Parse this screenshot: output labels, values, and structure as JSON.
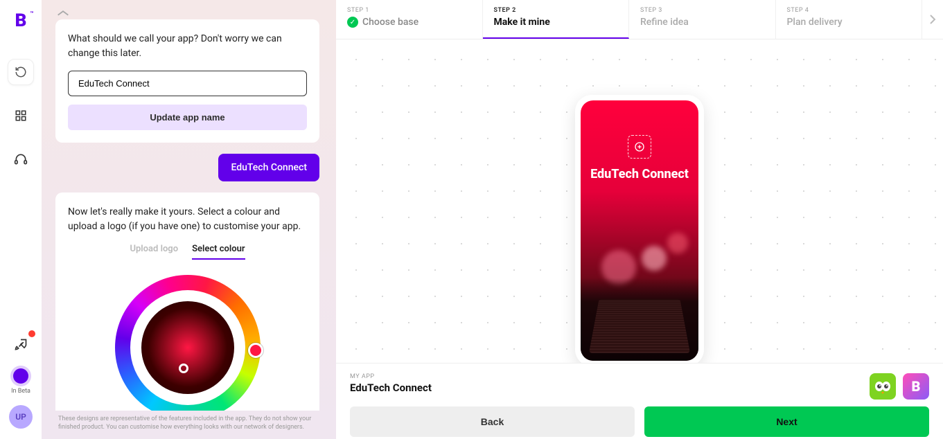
{
  "sidebar": {
    "logo": "B",
    "beta_label": "In Beta",
    "avatar_initials": "UP"
  },
  "chat": {
    "card1": {
      "text": "What should we call your app? Don't worry we can change this later.",
      "input_value": "EduTech Connect",
      "button": "Update app name"
    },
    "user_reply": "EduTech Connect",
    "card2": {
      "text": "Now let's really make it yours. Select a colour and upload a logo (if you have one) to customise your app.",
      "tab_upload": "Upload logo",
      "tab_colour": "Select colour"
    },
    "footer_note": "These designs are representative of the features included in the app. They do not show your finished product. You can customise how everything looks with our network of designers."
  },
  "steps": {
    "s1": {
      "label": "STEP 1",
      "name": "Choose base"
    },
    "s2": {
      "label": "STEP 2",
      "name": "Make it mine"
    },
    "s3": {
      "label": "STEP 3",
      "name": "Refine idea"
    },
    "s4": {
      "label": "STEP 4",
      "name": "Plan delivery"
    }
  },
  "phone": {
    "title": "EduTech Connect"
  },
  "bottom": {
    "my_app_label": "MY APP",
    "app_name": "EduTech Connect",
    "back": "Back",
    "next": "Next"
  }
}
